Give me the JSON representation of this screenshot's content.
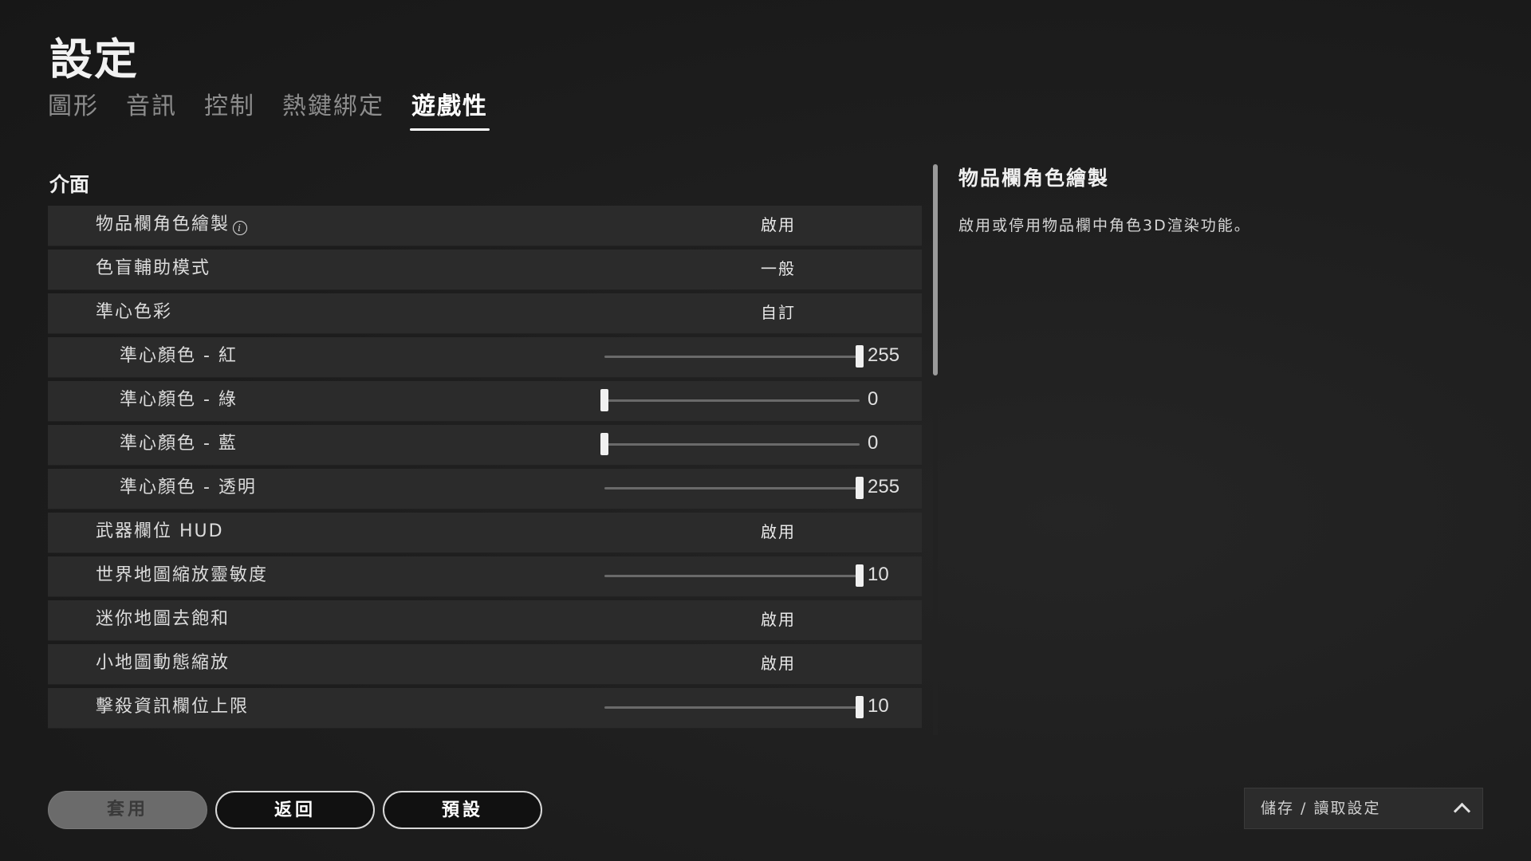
{
  "page": {
    "title": "設定"
  },
  "tabs": [
    {
      "label": "圖形",
      "active": false
    },
    {
      "label": "音訊",
      "active": false
    },
    {
      "label": "控制",
      "active": false
    },
    {
      "label": "熱鍵綁定",
      "active": false
    },
    {
      "label": "遊戲性",
      "active": true
    }
  ],
  "section": {
    "title": "介面"
  },
  "rows": [
    {
      "label": "物品欄角色繪製",
      "info": "i",
      "type": "value",
      "value": "啟用"
    },
    {
      "label": "色盲輔助模式",
      "type": "value",
      "value": "一般"
    },
    {
      "label": "準心色彩",
      "type": "value",
      "value": "自訂"
    },
    {
      "label": "準心顏色 - 紅",
      "type": "slider",
      "sub": true,
      "value": "255",
      "fraction": 1.0
    },
    {
      "label": "準心顏色 - 綠",
      "type": "slider",
      "sub": true,
      "value": "0",
      "fraction": 0.0
    },
    {
      "label": "準心顏色 - 藍",
      "type": "slider",
      "sub": true,
      "value": "0",
      "fraction": 0.0
    },
    {
      "label": "準心顏色 - 透明",
      "type": "slider",
      "sub": true,
      "value": "255",
      "fraction": 1.0
    },
    {
      "label": "武器欄位 HUD",
      "type": "value",
      "value": "啟用"
    },
    {
      "label": "世界地圖縮放靈敏度",
      "type": "slider",
      "value": "10",
      "fraction": 1.0
    },
    {
      "label": "迷你地圖去飽和",
      "type": "value",
      "value": "啟用"
    },
    {
      "label": "小地圖動態縮放",
      "type": "value",
      "value": "啟用"
    },
    {
      "label": "擊殺資訊欄位上限",
      "type": "slider",
      "value": "10",
      "fraction": 1.0
    }
  ],
  "description": {
    "title": "物品欄角色繪製",
    "text": "啟用或停用物品欄中角色3D渲染功能。"
  },
  "buttons": {
    "apply": "套用",
    "back": "返回",
    "default": "預設"
  },
  "save_load": {
    "label": "儲存 / 讀取設定",
    "icon": "chevron-up-icon"
  },
  "scroll": {
    "position_fraction": 0.0,
    "visible_fraction": 0.37
  }
}
